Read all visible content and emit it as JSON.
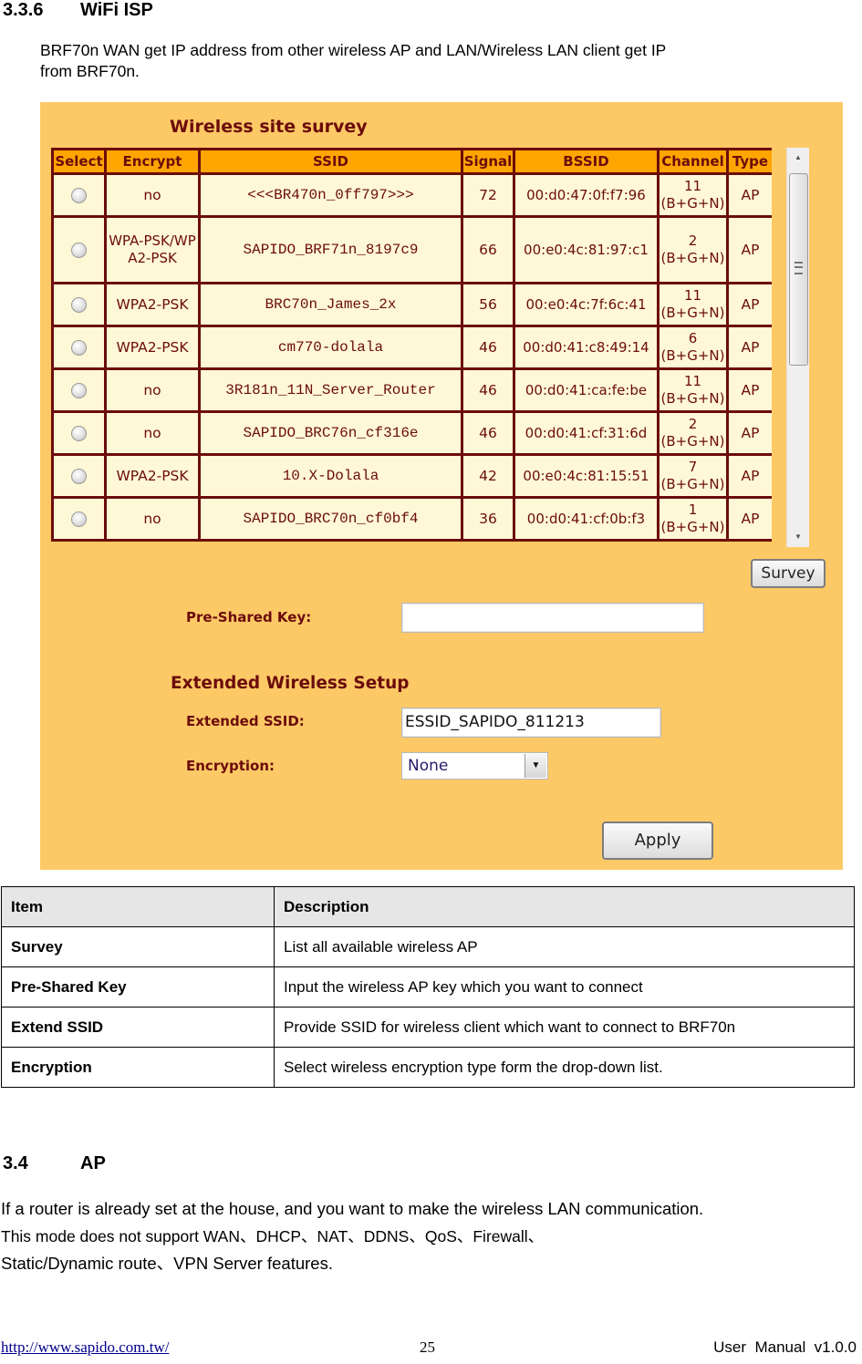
{
  "section_336": {
    "number": "3.3.6",
    "title": "WiFi ISP"
  },
  "intro_text_line1": "BRF70n WAN get IP address from other wireless AP and LAN/Wireless LAN client get IP",
  "intro_text_line2": "from BRF70n.",
  "screenshot": {
    "title": "Wireless site survey",
    "columns": [
      "Select",
      "Encrypt",
      "SSID",
      "Signal",
      "BSSID",
      "Channel",
      "Type"
    ],
    "rows": [
      {
        "encrypt": "no",
        "ssid": "<<<BR470n_0ff797>>>",
        "signal": "72",
        "bssid": "00:d0:47:0f:f7:96",
        "channel": "11",
        "band": "(B+G+N)",
        "type": "AP"
      },
      {
        "encrypt": "WPA-PSK/WPA2-PSK",
        "ssid": "SAPIDO_BRF71n_8197c9",
        "signal": "66",
        "bssid": "00:e0:4c:81:97:c1",
        "channel": "2",
        "band": "(B+G+N)",
        "type": "AP"
      },
      {
        "encrypt": "WPA2-PSK",
        "ssid": "BRC70n_James_2x",
        "signal": "56",
        "bssid": "00:e0:4c:7f:6c:41",
        "channel": "11",
        "band": "(B+G+N)",
        "type": "AP"
      },
      {
        "encrypt": "WPA2-PSK",
        "ssid": "cm770-dolala",
        "signal": "46",
        "bssid": "00:d0:41:c8:49:14",
        "channel": "6",
        "band": "(B+G+N)",
        "type": "AP"
      },
      {
        "encrypt": "no",
        "ssid": "3R181n_11N_Server_Router",
        "signal": "46",
        "bssid": "00:d0:41:ca:fe:be",
        "channel": "11",
        "band": "(B+G+N)",
        "type": "AP"
      },
      {
        "encrypt": "no",
        "ssid": "SAPIDO_BRC76n_cf316e",
        "signal": "46",
        "bssid": "00:d0:41:cf:31:6d",
        "channel": "2",
        "band": "(B+G+N)",
        "type": "AP"
      },
      {
        "encrypt": "WPA2-PSK",
        "ssid": "10.X-Dolala",
        "signal": "42",
        "bssid": "00:e0:4c:81:15:51",
        "channel": "7",
        "band": "(B+G+N)",
        "type": "AP"
      },
      {
        "encrypt": "no",
        "ssid": "SAPIDO_BRC70n_cf0bf4",
        "signal": "36",
        "bssid": "00:d0:41:cf:0b:f3",
        "channel": "1",
        "band": "(B+G+N)",
        "type": "AP"
      }
    ],
    "survey_button": "Survey",
    "pre_shared_key_label": "Pre-Shared Key:",
    "pre_shared_key_value": "",
    "extended_section_title": "Extended Wireless Setup",
    "extended_ssid_label": "Extended SSID:",
    "extended_ssid_value": "ESSID_SAPIDO_811213",
    "encryption_label": "Encryption:",
    "encryption_value": "None",
    "apply_button": "Apply",
    "colors": {
      "panel_bg": "#fdc966",
      "header_bg": "#ffa500",
      "cell_bg": "#fff8d6",
      "border": "#6b0c0c"
    }
  },
  "desc_table": {
    "headers": [
      "Item",
      "Description"
    ],
    "rows": [
      {
        "item": "Survey",
        "description": "List all available wireless AP"
      },
      {
        "item": "Pre-Shared Key",
        "description": "Input the wireless AP key which you want to connect"
      },
      {
        "item": "Extend SSID",
        "description": "Provide SSID for wireless client which want to connect to BRF70n"
      },
      {
        "item": "Encryption",
        "description": "Select wireless encryption type form the drop-down list."
      }
    ]
  },
  "section_34": {
    "number": "3.4",
    "title": "AP"
  },
  "ap_text_line1": "If a router is already set at the house, and you want to make the wireless LAN communication.",
  "ap_text_line2": "This mode does not support WAN、DHCP、NAT、DDNS、QoS、Firewall、",
  "ap_text_line3": "Static/Dynamic route、VPN Server features.",
  "footer": {
    "url": "http://www.sapido.com.tw/",
    "page": "25",
    "manual": "User  Manual  v1.0.0"
  }
}
